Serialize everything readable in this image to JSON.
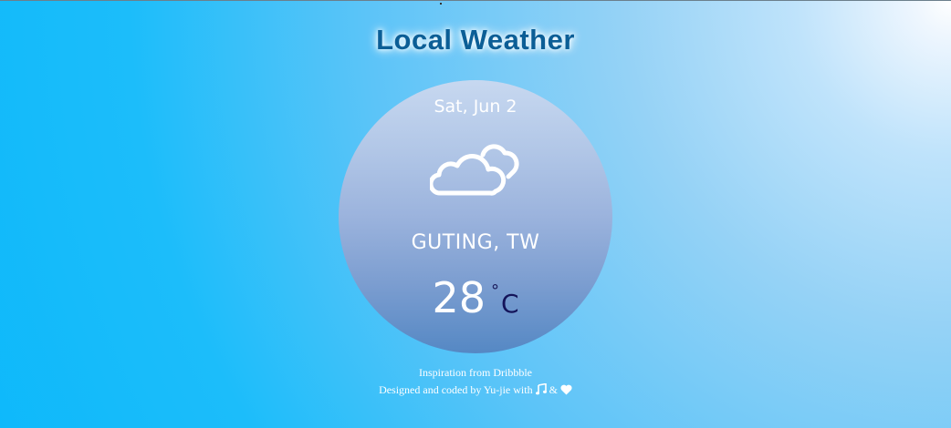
{
  "page": {
    "title": "Local Weather"
  },
  "weather": {
    "date": "Sat, Jun 2",
    "condition_icon": "clouds-icon",
    "location": "GUTING, TW",
    "temperature": "28",
    "degree_symbol": "°",
    "unit": "C"
  },
  "footer": {
    "inspiration": "Inspiration from Dribbble",
    "credit_prefix": "Designed and coded by Yu-jie with",
    "credit_and": "&",
    "music_icon": "music-note-icon",
    "heart_icon": "heart-icon"
  },
  "colors": {
    "title": "#0b5e96",
    "card_top": "#c7d8f0",
    "card_bottom": "#5588c4",
    "unit_text": "#14145a",
    "background_main": "#0bb8fb"
  }
}
